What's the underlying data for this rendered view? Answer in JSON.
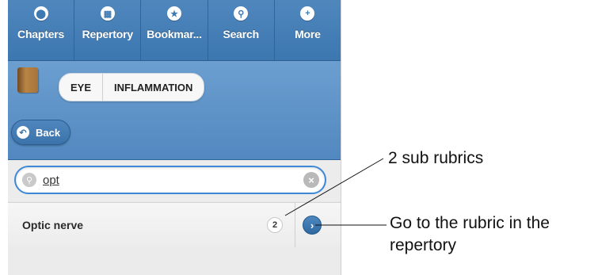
{
  "tabs": [
    {
      "label": "Chapters",
      "icon": "chapters-icon",
      "glyph": "⬤"
    },
    {
      "label": "Repertory",
      "icon": "grid-icon",
      "glyph": "▦"
    },
    {
      "label": "Bookmar...",
      "icon": "star-icon",
      "glyph": "★"
    },
    {
      "label": "Search",
      "icon": "search-icon",
      "glyph": "⚲"
    },
    {
      "label": "More",
      "icon": "plus-icon",
      "glyph": "+"
    }
  ],
  "breadcrumb": [
    "EYE",
    "INFLAMMATION"
  ],
  "back_label": "Back",
  "search": {
    "value": "opt"
  },
  "result": {
    "name": "Optic nerve",
    "count": "2"
  },
  "annotations": {
    "sub_rubrics": "2 sub rubrics",
    "go_to_rubric": "Go to the rubric in the repertory"
  },
  "colors": {
    "accent": "#3e79b2",
    "header": "#5a8fc6",
    "focus": "#3e88d8"
  }
}
